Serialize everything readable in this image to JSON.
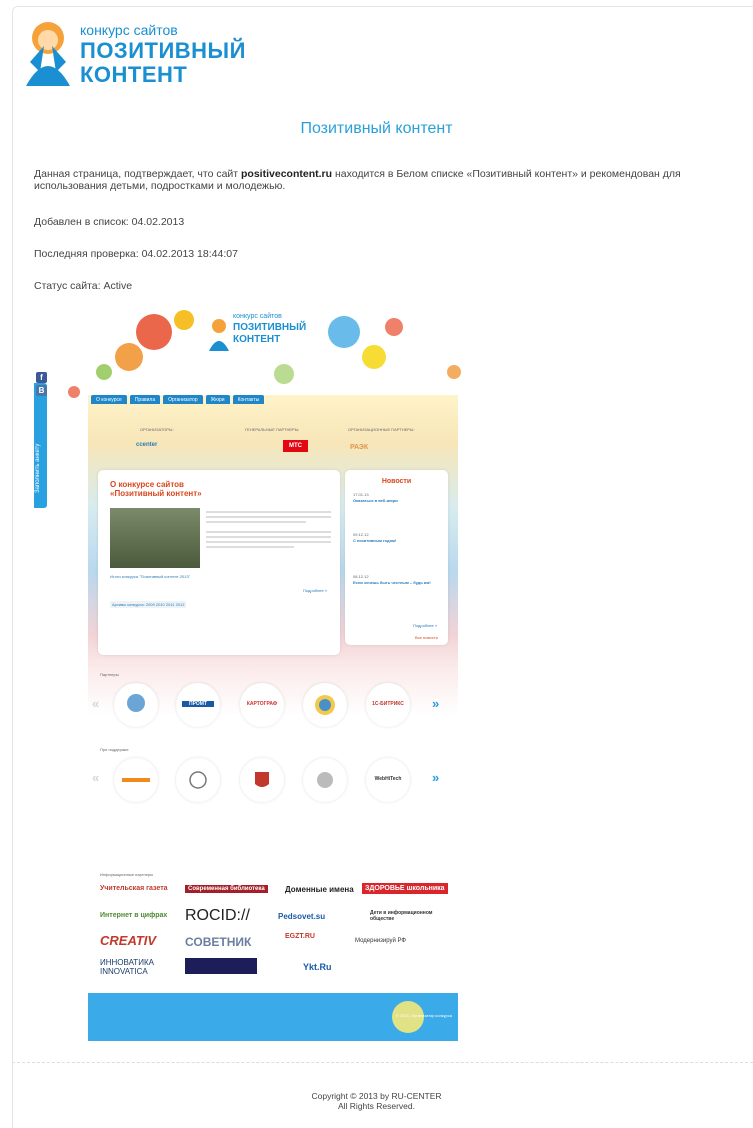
{
  "logo": {
    "line1": "конкурс сайтов",
    "line2": "ПОЗИТИВНЫЙ",
    "line3": "КОНТЕНТ"
  },
  "heading": "Позитивный контент",
  "description": {
    "pre": "Данная страница, подтверждает, что сайт ",
    "site": "positivecontent.ru",
    "post": " находится в Белом списке «Позитивный контент» и рекомендован для использования детьми, подростками и молодежью."
  },
  "added": {
    "label": "Добавлен в список:",
    "value": "04.02.2013"
  },
  "last_check": {
    "label": "Последняя проверка:",
    "value": "04.02.2013 18:44:07"
  },
  "status": {
    "label": "Статус сайта:",
    "value": "Active"
  },
  "screenshot": {
    "logo": {
      "line1": "конкурс сайтов",
      "line2": "ПОЗИТИВНЫЙ",
      "line3": "КОНТЕНТ"
    },
    "nav": [
      "О конкурсе",
      "Правила",
      "Организатор",
      "Жюри",
      "Контакты"
    ],
    "sidebar_tab": "Заполнить анкету",
    "social": [
      "f",
      "B"
    ],
    "org_headers": [
      "ОРГАНИЗАТОРЫ:",
      "ГЕНЕРАЛЬНЫЕ ПАРТНЕРЫ:",
      "ОРГАНИЗАЦИОННЫЕ ПАРТНЕРЫ:"
    ],
    "org_logos": [
      "ccenter",
      "МТС",
      "РАЭК"
    ],
    "about": {
      "title": "О конкурсе сайтов «Позитивный контент»",
      "more": "Подробнее »",
      "archive": "Архивы конкурса: 2009 2010 2011 2012",
      "winners": "Итоги конкурса \"Позитивный контент 2013\""
    },
    "news": {
      "title": "Новости",
      "items": [
        {
          "date": "17.01.13",
          "title": "Оказаться в веб-жюри"
        },
        {
          "date": "09.12.12",
          "title": "С позитивным годом!"
        },
        {
          "date": "08.12.12",
          "title": "Если хочешь быть честным – будь им!"
        }
      ],
      "more": "Подробнее »",
      "all": "Все новости"
    },
    "partners_label": "Партнеры",
    "partners": [
      "ПРОМТ",
      "КАРТОГРАФ",
      "",
      "",
      "1С-БИТРИКС"
    ],
    "support_label": "При поддержке",
    "support": [
      "",
      "",
      "",
      "",
      "WebHiTech"
    ],
    "info_label": "Информационные партнеры",
    "info_partners": [
      "Учительская газета",
      "Современная библиотека",
      "Доменные имена",
      "ЗДОРОВЬЕ школьника",
      "Интернет в цифрах",
      "ROCID://",
      "Pedsovet.su",
      "Дети в информационном обществе",
      "CREATIV",
      "СОВЕТНИК",
      "EGZT.RU",
      "Модернизируй РФ",
      "ИННОВАТИКА INNOVATICA",
      "",
      "Ykt.Ru"
    ],
    "copyright": "© 2013, Организатор конкурса"
  },
  "footer": {
    "line1": "Copyright © 2013 by RU-CENTER",
    "line2": "All Rights Reserved."
  },
  "colors": {
    "accent": "#2aa0d8",
    "brand": "#1a8fd1",
    "nav": "#1f86c8",
    "news_title": "#d9461e"
  }
}
